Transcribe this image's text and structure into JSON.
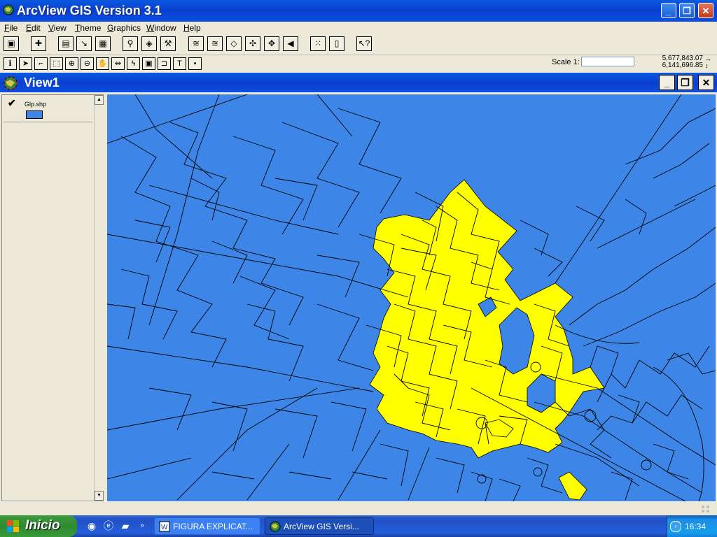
{
  "app": {
    "title": "ArcView GIS Version 3.1"
  },
  "menu": [
    "File",
    "Edit",
    "View",
    "Theme",
    "Graphics",
    "Window",
    "Help"
  ],
  "toolbar1": {
    "buttons": [
      "save-icon",
      "add-theme-icon",
      "theme-properties-icon",
      "edit-legend-icon",
      "open-table-icon",
      "find-icon",
      "locate-address-icon",
      "query-builder-icon",
      "zoom-to-full-extent-icon",
      "zoom-to-themes-icon",
      "zoom-to-selected-icon",
      "zoom-in-icon",
      "zoom-out-icon",
      "zoom-previous-icon",
      "select-features-icon",
      "clear-selection-icon",
      "help-icon"
    ]
  },
  "toolbar2": {
    "tools": [
      "identify-tool",
      "pointer-tool",
      "vertex-edit-tool",
      "select-feature-tool",
      "zoom-in-tool",
      "zoom-out-tool",
      "pan-tool",
      "measure-tool",
      "hotlink-tool",
      "area-of-interest-tool",
      "label-tool",
      "text-tool",
      "draw-point-tool"
    ],
    "scale_label": "Scale 1:",
    "scale_value": "",
    "coord_x": "5,677,843.07",
    "coord_y": "6,141,696.85"
  },
  "view": {
    "title": "View1",
    "theme": {
      "name": "Glp.shp",
      "checked": true,
      "color": "#3d86e8"
    }
  },
  "map": {
    "background": "#3d86e8",
    "selection_color": "#ffff00",
    "outline_color": "#000000"
  },
  "taskbar": {
    "start_label": "Inicio",
    "tasks": [
      {
        "label": "FIGURA EXPLICAT...",
        "active": false
      },
      {
        "label": "ArcView GIS Versi...",
        "active": true
      }
    ],
    "clock": "16:34"
  }
}
